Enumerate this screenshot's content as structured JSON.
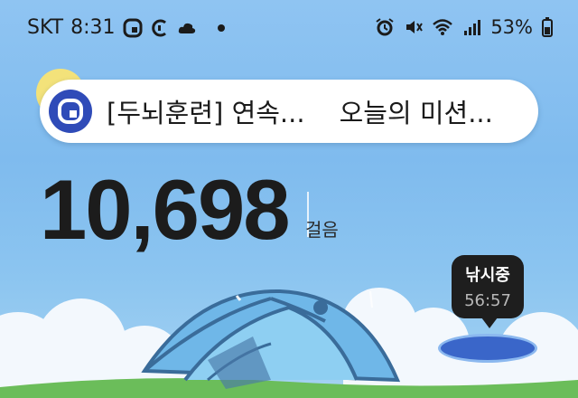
{
  "status_bar": {
    "carrier": "SKT",
    "time": "8:31",
    "battery": "53%"
  },
  "banner": {
    "text_left": "[두뇌훈련] 연속...",
    "text_right": "오늘의 미션..."
  },
  "steps": {
    "count": "10,698",
    "unit": "걸음"
  },
  "fishing": {
    "label": "낚시중",
    "timer": "56:57"
  },
  "colors": {
    "sky": "#8fc4f2",
    "logo": "#2f4bb8",
    "hole": "#3a66c9"
  }
}
